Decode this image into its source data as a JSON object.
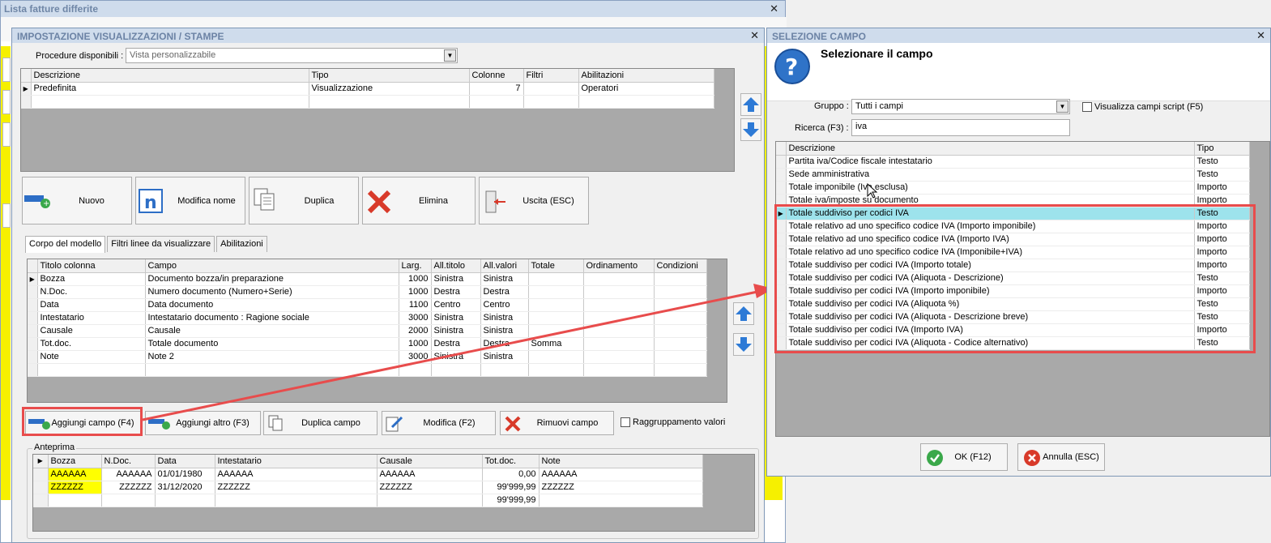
{
  "background_window": {
    "title": "Lista fatture differite"
  },
  "main_dialog": {
    "title": "IMPOSTAZIONE VISUALIZZAZIONI / STAMPE",
    "procedure_label": "Procedure disponibili :",
    "procedure_value": "Vista personalizzabile",
    "views_columns": [
      "Descrizione",
      "Tipo",
      "Colonne",
      "Filtri",
      "Abilitazioni"
    ],
    "views_rows": [
      [
        "Predefinita",
        "Visualizzazione",
        "7",
        "",
        "Operatori"
      ]
    ],
    "buttons": {
      "nuovo": "Nuovo",
      "modifica_nome": "Modifica nome",
      "duplica": "Duplica",
      "elimina": "Elimina",
      "uscita": "Uscita (ESC)"
    },
    "tabs": [
      "Corpo del modello",
      "Filtri linee da visualizzare",
      "Abilitazioni"
    ],
    "fields_columns": [
      "Titolo colonna",
      "Campo",
      "Larg.",
      "All.titolo",
      "All.valori",
      "Totale",
      "Ordinamento",
      "Condizioni"
    ],
    "fields_rows": [
      [
        "Bozza",
        "Documento bozza/in preparazione",
        "1000",
        "Sinistra",
        "Sinistra",
        "",
        "",
        ""
      ],
      [
        "N.Doc.",
        "Numero documento (Numero+Serie)",
        "1000",
        "Destra",
        "Destra",
        "",
        "",
        ""
      ],
      [
        "Data",
        "Data documento",
        "1100",
        "Centro",
        "Centro",
        "",
        "",
        ""
      ],
      [
        "Intestatario",
        "Intestatario documento : Ragione sociale",
        "3000",
        "Sinistra",
        "Sinistra",
        "",
        "",
        ""
      ],
      [
        "Causale",
        "Causale",
        "2000",
        "Sinistra",
        "Sinistra",
        "",
        "",
        ""
      ],
      [
        "Tot.doc.",
        "Totale documento",
        "1000",
        "Destra",
        "Destra",
        "Somma",
        "",
        ""
      ],
      [
        "Note",
        "Note 2",
        "3000",
        "Sinistra",
        "Sinistra",
        "",
        "",
        ""
      ]
    ],
    "field_buttons": {
      "aggiungi_campo": "Aggiungi campo (F4)",
      "aggiungi_altro": "Aggiungi altro (F3)",
      "duplica_campo": "Duplica campo",
      "modifica": "Modifica (F2)",
      "rimuovi_campo": "Rimuovi campo"
    },
    "raggruppamento_label": "Raggruppamento valori",
    "preview": {
      "legend": "Anteprima",
      "columns": [
        "Bozza",
        "N.Doc.",
        "Data",
        "Intestatario",
        "Causale",
        "Tot.doc.",
        "Note"
      ],
      "rows": [
        [
          "AAAAAA",
          "AAAAAA",
          "01/01/1980",
          "AAAAAA",
          "AAAAAA",
          "0,00",
          "AAAAAA"
        ],
        [
          "ZZZZZZ",
          "ZZZZZZ",
          "31/12/2020",
          "ZZZZZZ",
          "ZZZZZZ",
          "99'999,99",
          "ZZZZZZ"
        ],
        [
          "",
          "",
          "",
          "",
          "",
          "99'999,99",
          ""
        ]
      ]
    }
  },
  "select_dialog": {
    "title": "SELEZIONE CAMPO",
    "heading": "Selezionare il campo",
    "gruppo_label": "Gruppo :",
    "gruppo_value": "Tutti i campi",
    "script_label": "Visualizza campi script (F5)",
    "ricerca_label": "Ricerca (F3) :",
    "ricerca_value": "iva",
    "columns": [
      "Descrizione",
      "Tipo"
    ],
    "rows": [
      [
        "Partita iva/Codice fiscale intestatario",
        "Testo"
      ],
      [
        "Sede amministrativa",
        "Testo"
      ],
      [
        "Totale imponibile (Iva esclusa)",
        "Importo"
      ],
      [
        "Totale iva/imposte su documento",
        "Importo"
      ],
      [
        "Totale suddiviso per codici IVA",
        "Testo"
      ],
      [
        "Totale relativo ad uno specifico codice IVA (Importo imponibile)",
        "Importo"
      ],
      [
        "Totale relativo ad uno specifico codice IVA (Importo IVA)",
        "Importo"
      ],
      [
        "Totale relativo ad uno specifico codice IVA (Imponibile+IVA)",
        "Importo"
      ],
      [
        "Totale suddiviso per codici IVA (Importo totale)",
        "Importo"
      ],
      [
        "Totale suddiviso per codici IVA (Aliquota - Descrizione)",
        "Testo"
      ],
      [
        "Totale suddiviso per codici IVA (Importo imponibile)",
        "Importo"
      ],
      [
        "Totale suddiviso per codici IVA (Aliquota %)",
        "Testo"
      ],
      [
        "Totale suddiviso per codici IVA (Aliquota - Descrizione breve)",
        "Testo"
      ],
      [
        "Totale suddiviso per codici IVA (Importo IVA)",
        "Importo"
      ],
      [
        "Totale suddiviso per codici IVA (Aliquota - Codice alternativo)",
        "Testo"
      ]
    ],
    "ok_label": "OK (F12)",
    "annulla_label": "Annulla (ESC)"
  },
  "colors": {
    "highlight": "#e84c4c",
    "selected_row": "#9de3ec",
    "preview_yellow": "#ffff00"
  }
}
